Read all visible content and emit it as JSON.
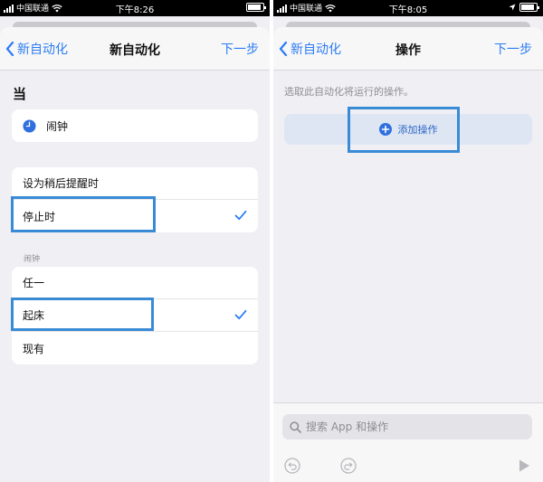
{
  "colors": {
    "accent": "#2b7cf6",
    "highlight": "#3a8bd6",
    "background": "#efeff4"
  },
  "left": {
    "status": {
      "carrier": "中国联通",
      "time": "下午8:26"
    },
    "nav": {
      "back_label": "新自动化",
      "title": "新自动化",
      "next_label": "下一步"
    },
    "section_title": "当",
    "trigger": {
      "icon": "clock-icon",
      "label": "闹钟"
    },
    "when_rows": [
      {
        "label": "设为稍后提醒时",
        "checked": false
      },
      {
        "label": "停止时",
        "checked": true
      }
    ],
    "alarm_group_label": "闹钟",
    "alarm_rows": [
      {
        "label": "任一",
        "checked": false
      },
      {
        "label": "起床",
        "checked": true
      },
      {
        "label": "现有",
        "checked": false
      }
    ]
  },
  "right": {
    "status": {
      "carrier": "中国联通",
      "time": "下午8:05"
    },
    "nav": {
      "back_label": "新自动化",
      "title": "操作",
      "next_label": "下一步"
    },
    "hint": "选取此自动化将运行的操作。",
    "add_action_label": "添加操作",
    "search": {
      "placeholder": "搜索 App 和操作",
      "value": ""
    },
    "toolbar": {
      "icons": [
        "undo-icon",
        "redo-icon",
        "play-icon"
      ]
    }
  }
}
